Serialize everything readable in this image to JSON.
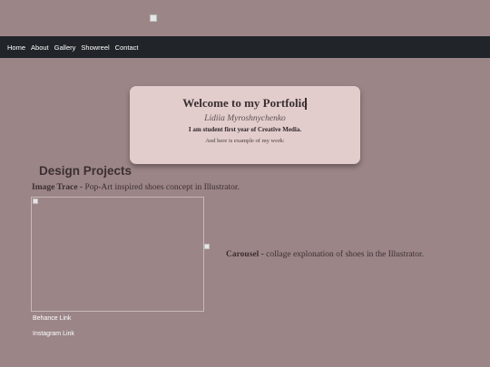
{
  "navbar": {
    "links": [
      "Home",
      "About",
      "Gallery",
      "Showreel",
      "Contact"
    ]
  },
  "welcome": {
    "title": "Welcome to my Portfolio",
    "name": "Lidiia Myroshnychenko",
    "subtitle": "I am student first year of Creative Media.",
    "example_text": "And here is example of my work:"
  },
  "projects": {
    "heading": "Design Projects",
    "image_trace": {
      "title": "Image Trace -",
      "description": "Pop-Art inspired shoes concept in Illustrator."
    },
    "carousel": {
      "title": "Carousel -",
      "description": "collage explonation of shoes in the Illustrator."
    }
  },
  "links": {
    "behance": "Behance Link",
    "instagram": "Instagram Link"
  }
}
